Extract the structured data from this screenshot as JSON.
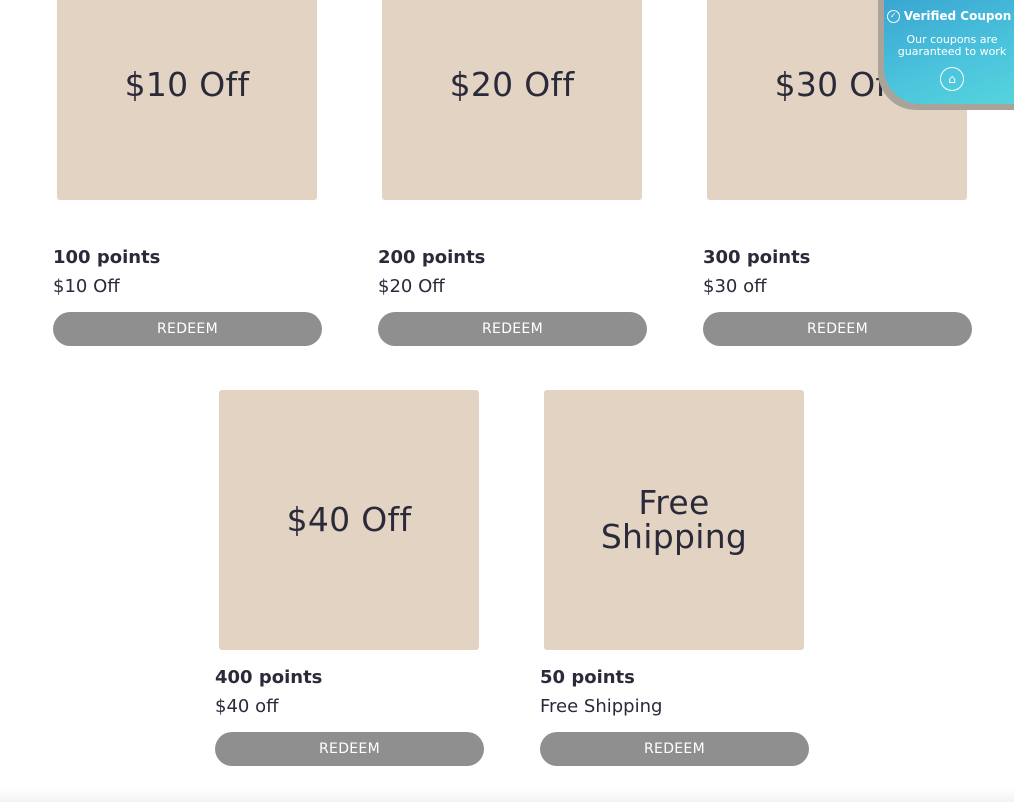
{
  "rewards": [
    {
      "tile_text": "$10 Off",
      "points": "100 points",
      "description": "$10 Off",
      "button": "REDEEM"
    },
    {
      "tile_text": "$20 Off",
      "points": "200 points",
      "description": "$20 Off",
      "button": "REDEEM"
    },
    {
      "tile_text": "$30 Off",
      "points": "300 points",
      "description": "$30 off",
      "button": "REDEEM"
    },
    {
      "tile_text": "$40 Off",
      "points": "400 points",
      "description": "$40 off",
      "button": "REDEEM"
    },
    {
      "tile_text": "Free\nShipping",
      "points": "50 points",
      "description": "Free Shipping",
      "button": "REDEEM"
    }
  ],
  "badge": {
    "title": "Verified Coupon",
    "subtitle": "Our coupons are guaranteed to work",
    "check_icon": "check-circle-icon",
    "logo_icon": "coupon-logo-icon"
  },
  "colors": {
    "tile": "#e3d3c2",
    "button": "#8f8f8f",
    "text": "#2a2a3a",
    "badge_gradient_start": "#3aa6d2",
    "badge_gradient_end": "#55d4dc"
  }
}
